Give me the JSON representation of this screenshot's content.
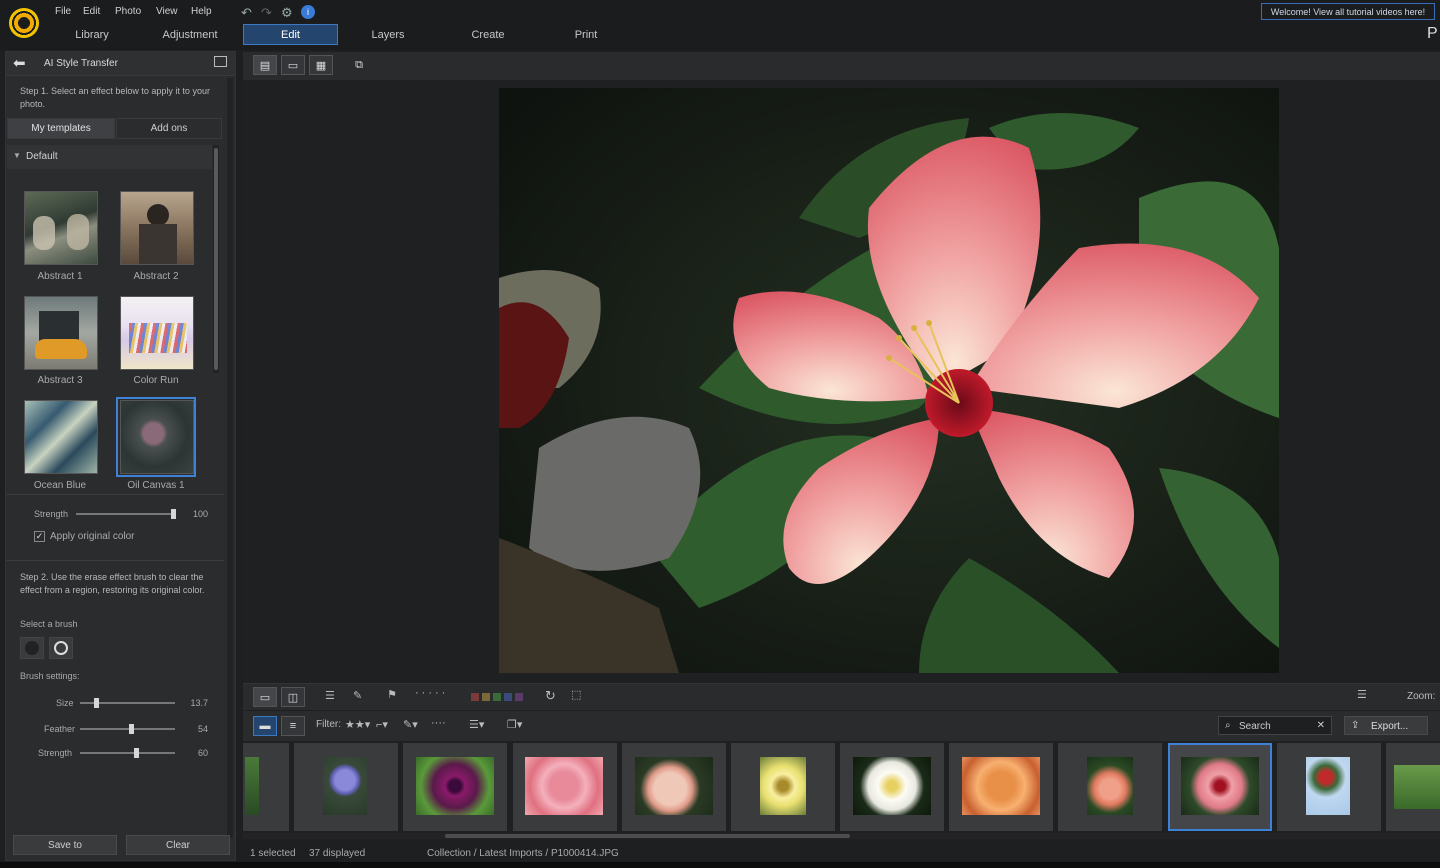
{
  "menu": {
    "items": [
      "File",
      "Edit",
      "Photo",
      "View",
      "Help"
    ],
    "welcome_link": "Welcome! View all tutorial videos here!"
  },
  "main_tabs": [
    "Library",
    "Adjustment",
    "Edit",
    "Layers",
    "Create",
    "Print"
  ],
  "corner_letter": "P",
  "panel": {
    "title": "AI Style Transfer",
    "step1": "Step 1. Select an effect below to apply it to your photo.",
    "tabs": [
      "My templates",
      "Add ons"
    ],
    "section": "Default",
    "templates": [
      "Abstract 1",
      "Abstract 2",
      "Abstract 3",
      "Color Run",
      "Ocean Blue",
      "Oil Canvas 1"
    ],
    "strength_label": "Strength",
    "strength_value": "100",
    "strength_level": 1.0,
    "apply_original_color": "Apply original color",
    "apply_original_color_checked": true,
    "step2": "Step 2. Use the erase effect brush to clear the effect from a region, restoring its original color.",
    "select_brush": "Select a brush",
    "brush_settings": "Brush settings:",
    "size_label": "Size",
    "size_value": "13.7",
    "size_level": 0.15,
    "feather_label": "Feather",
    "feather_value": "54",
    "feather_level": 0.54,
    "brush_strength_label": "Strength",
    "brush_strength_value": "60",
    "brush_strength_level": 0.6,
    "save_to": "Save to",
    "clear": "Clear"
  },
  "toolbar": {
    "filter_label": "Filter:",
    "search_placeholder": "Search",
    "export_label": "Export...",
    "zoom_label": "Zoom:"
  },
  "status": {
    "selected": "1 selected",
    "displayed": "37 displayed",
    "path": "Collection / Latest Imports / P1000414.JPG"
  },
  "colors": {
    "accent": "#3d82d6",
    "active_tab_bg": "#24466e"
  },
  "icons": [
    "undo-icon",
    "redo-icon",
    "gear-icon",
    "info-icon",
    "back-arrow-icon",
    "expand-icon",
    "rotate-icon",
    "search-icon",
    "close-icon",
    "export-icon"
  ]
}
